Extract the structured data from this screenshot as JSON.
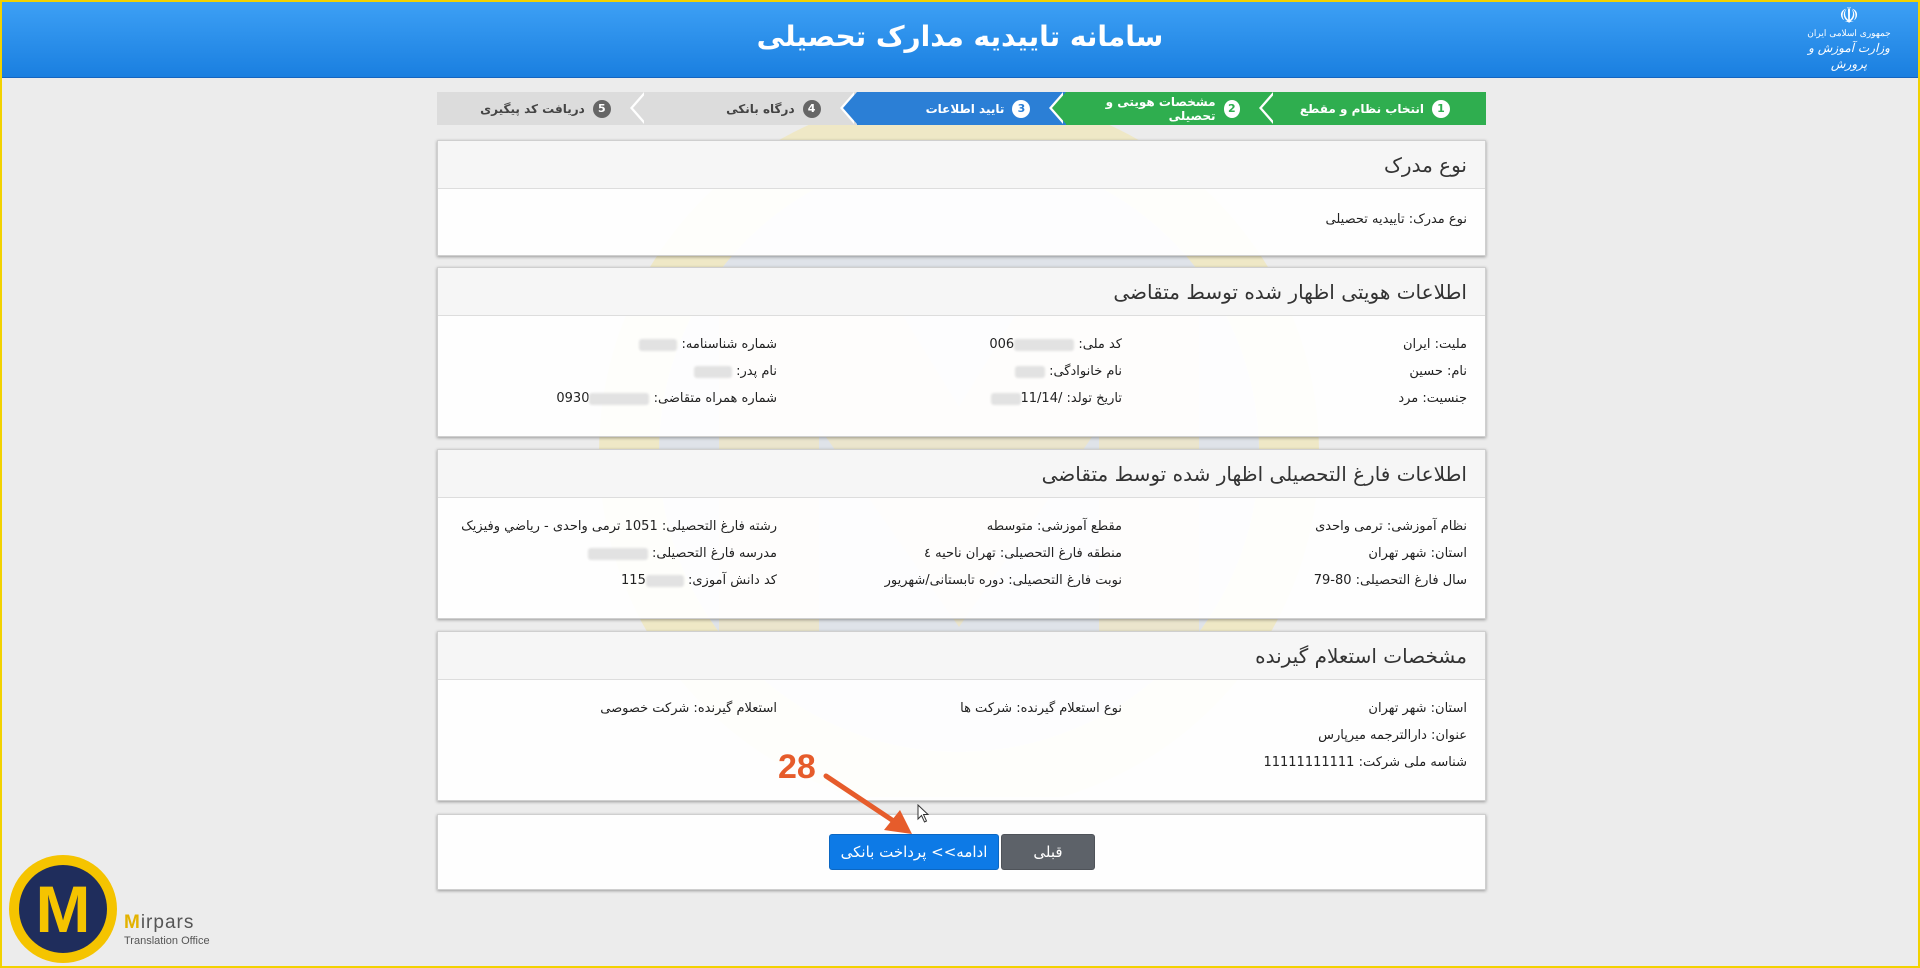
{
  "header": {
    "title": "سامانه تاییدیه مدارک تحصیلی",
    "ministry_line1": "جمهوری اسلامی ایران",
    "ministry_line2": "وزارت آموزش و پرورش"
  },
  "wizard": {
    "steps": [
      {
        "num": "1",
        "label": "انتخاب نظام و مقطع",
        "state": "done"
      },
      {
        "num": "2",
        "label": "مشخصات هویتی و تحصیلی",
        "state": "done"
      },
      {
        "num": "3",
        "label": "تایید اطلاعات",
        "state": "active"
      },
      {
        "num": "4",
        "label": "درگاه بانکی",
        "state": "todo"
      },
      {
        "num": "5",
        "label": "دریافت کد پیگیری",
        "state": "todo"
      }
    ]
  },
  "doc_type": {
    "title": "نوع مدرک",
    "field": "نوع مدرک: تاییدیه تحصیلی"
  },
  "identity": {
    "title": "اطلاعات هویتی اظهار شده توسط متقاضی",
    "nationality": "ملیت: ایران",
    "national_code_label": "کد ملی:",
    "national_code_value": "006",
    "id_number_label": "شماره شناسنامه:",
    "first_name": "نام: حسین",
    "last_name_label": "نام خانوادگی:",
    "father_name_label": "نام پدر:",
    "gender": "جنسیت: مرد",
    "birth_date_label": "تاریخ تولد:",
    "birth_date_value": "/11/14",
    "mobile_label": "شماره همراه متقاضی:",
    "mobile_value": "0930"
  },
  "graduation": {
    "title": "اطلاعات فارغ التحصیلی اظهار شده توسط متقاضی",
    "system": "نظام آموزشی: ترمی واحدی",
    "level": "مقطع آموزشی: متوسطه",
    "field_of_study": "رشته فارغ التحصیلی: 1051 ترمی واحدی - رياضي وفيزيک",
    "province": "استان: شهر تهران",
    "region": "منطقه فارغ التحصیلی: تهران ناحیه ٤",
    "school_label": "مدرسه فارغ التحصیلی:",
    "grad_year": "سال فارغ التحصیلی: 80-79",
    "grad_turn": "نوبت فارغ التحصیلی: دوره تابستانی/شهریور",
    "student_code_label": "کد دانش آموزی:",
    "student_code_value": "115"
  },
  "inquirer": {
    "title": "مشخصات استعلام گیرنده",
    "province": "استان: شهر تهران",
    "type": "نوع استعلام گیرنده: شرکت ها",
    "inquirer": "استعلام گیرنده: شرکت خصوصی",
    "name": "عنوان: دارالترجمه میرپارس",
    "company_id": "شناسه ملی شرکت: 11111111111"
  },
  "buttons": {
    "prev": "قبلی",
    "next": "ادامه>> پرداخت بانکی"
  },
  "annotation": {
    "number": "28"
  },
  "brand": {
    "letter": "M",
    "name_first": "M",
    "name_rest": "irpars",
    "sub": "Translation Office"
  },
  "colors": {
    "header": "#1a7fe0",
    "step_done": "#2fae4f",
    "step_active": "#2b7fd6",
    "btn_next": "#0d7ae6",
    "btn_prev": "#5d6269",
    "annotation": "#e65c2b",
    "brand_gold": "#f5c400",
    "brand_navy": "#1f2d5c"
  }
}
